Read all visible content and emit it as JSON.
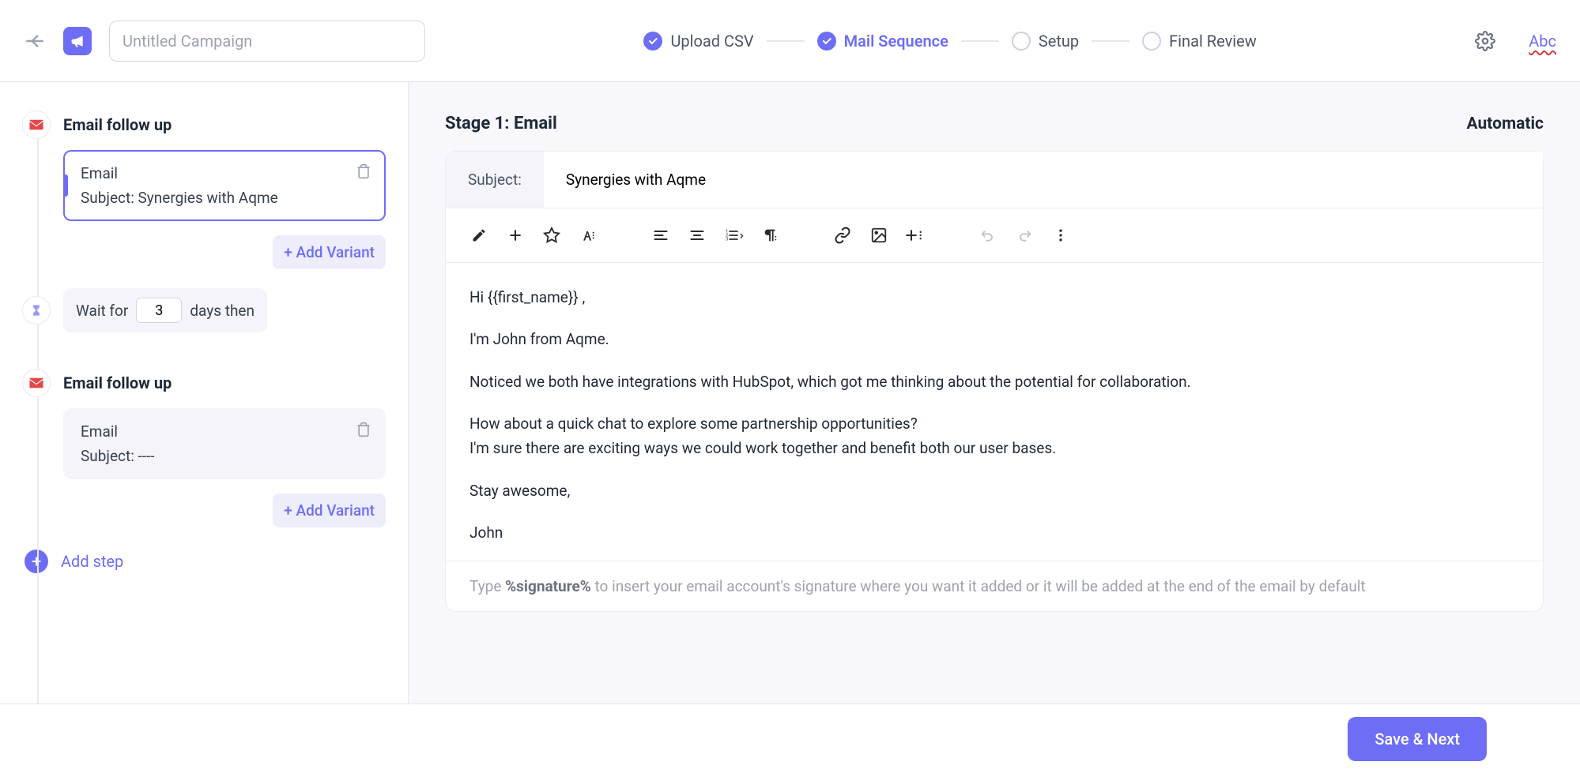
{
  "header": {
    "campaign_placeholder": "Untitled Campaign",
    "steps": [
      {
        "label": "Upload CSV",
        "state": "done"
      },
      {
        "label": "Mail Sequence",
        "state": "active"
      },
      {
        "label": "Setup",
        "state": "pending"
      },
      {
        "label": "Final Review",
        "state": "pending"
      }
    ],
    "abc_label": "Abc"
  },
  "sidebar": {
    "stage1": {
      "title": "Email follow up",
      "card_type": "Email",
      "card_subject": "Subject: Synergies with Aqme",
      "add_variant": "+ Add Variant"
    },
    "wait": {
      "prefix": "Wait for",
      "value": "3",
      "suffix": "days then"
    },
    "stage2": {
      "title": "Email follow up",
      "card_type": "Email",
      "card_subject": "Subject: ----",
      "add_variant": "+ Add Variant"
    },
    "add_step": "Add step"
  },
  "panel": {
    "title": "Stage 1: Email",
    "mode": "Automatic",
    "subject_label": "Subject:",
    "subject_value": "Synergies with Aqme",
    "body": {
      "l1": "Hi {{first_name}} ,",
      "l2": "I'm John from Aqme.",
      "l3": "Noticed we both have integrations with HubSpot, which got me thinking about the potential for collaboration.",
      "l4a": "How about a quick chat to explore some partnership opportunities?",
      "l4b": "I'm sure there are exciting ways we could work together and benefit both our user bases.",
      "l5": "Stay awesome,",
      "l6": "John"
    },
    "signature_hint_pre": "Type ",
    "signature_token": "%signature%",
    "signature_hint_post": " to insert your email account's signature where you want it added or it will be added at the end of the email by default"
  },
  "footer": {
    "save_label": "Save & Next"
  }
}
